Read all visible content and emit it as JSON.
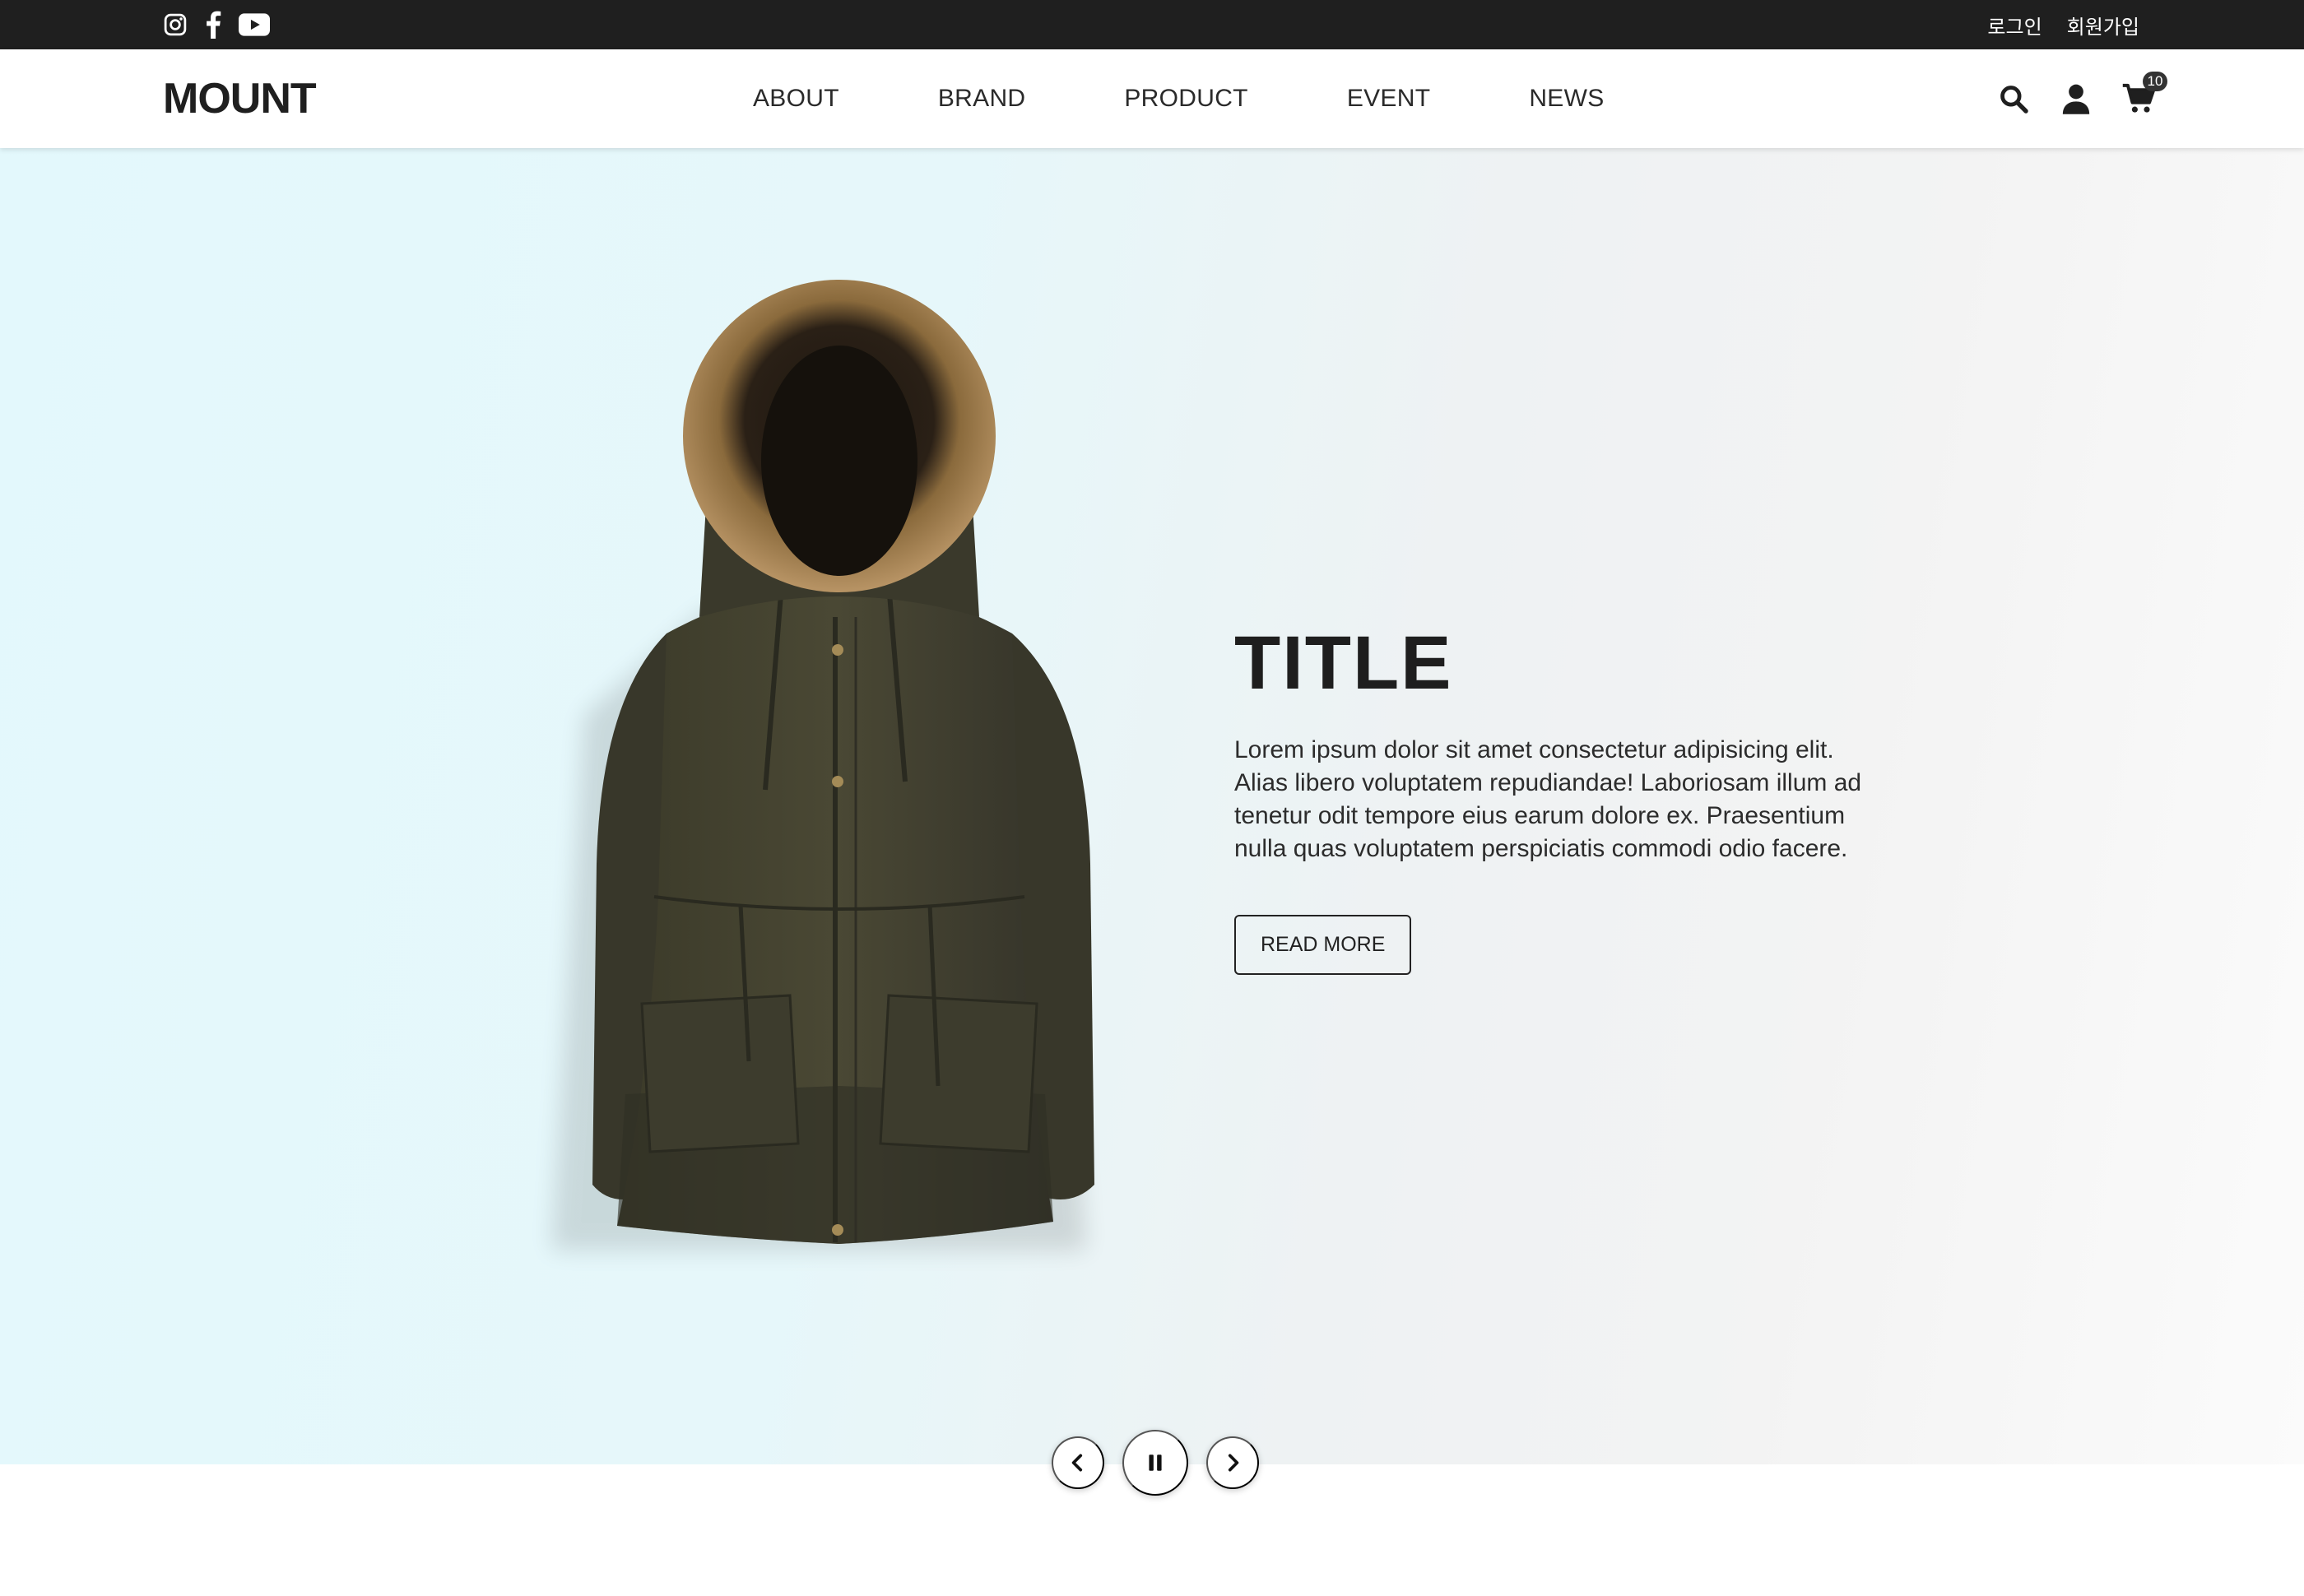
{
  "topbar": {
    "social": [
      {
        "name": "instagram-icon"
      },
      {
        "name": "facebook-icon"
      },
      {
        "name": "youtube-icon"
      }
    ],
    "auth": {
      "login": "로그인",
      "signup": "회원가입"
    }
  },
  "header": {
    "logo": "MOUNT",
    "nav": [
      "ABOUT",
      "BRAND",
      "PRODUCT",
      "EVENT",
      "NEWS"
    ],
    "icons": [
      "search-icon",
      "user-icon",
      "cart-icon"
    ],
    "cart_count": "10"
  },
  "hero": {
    "title": "TITLE",
    "description": "Lorem ipsum dolor sit amet consectetur adipisicing elit. Alias libero voluptatem repudiandae! Laboriosam illum ad tenetur odit tempore eius earum dolore ex. Praesentium nulla quas voluptatem perspiciatis commodi odio facere.",
    "button": "READ MORE",
    "image": "green-parka-jacket"
  },
  "slider_controls": [
    "prev-icon",
    "pause-icon",
    "next-icon"
  ],
  "colors": {
    "topbar_bg": "#1f1f1f",
    "header_bg": "#ffffff",
    "hero_left": "#e3f8fc",
    "hero_right": "#f3f3f3",
    "jacket": "#44432f",
    "fur": "#9a7a4a",
    "text_dark": "#1e1e1e"
  }
}
